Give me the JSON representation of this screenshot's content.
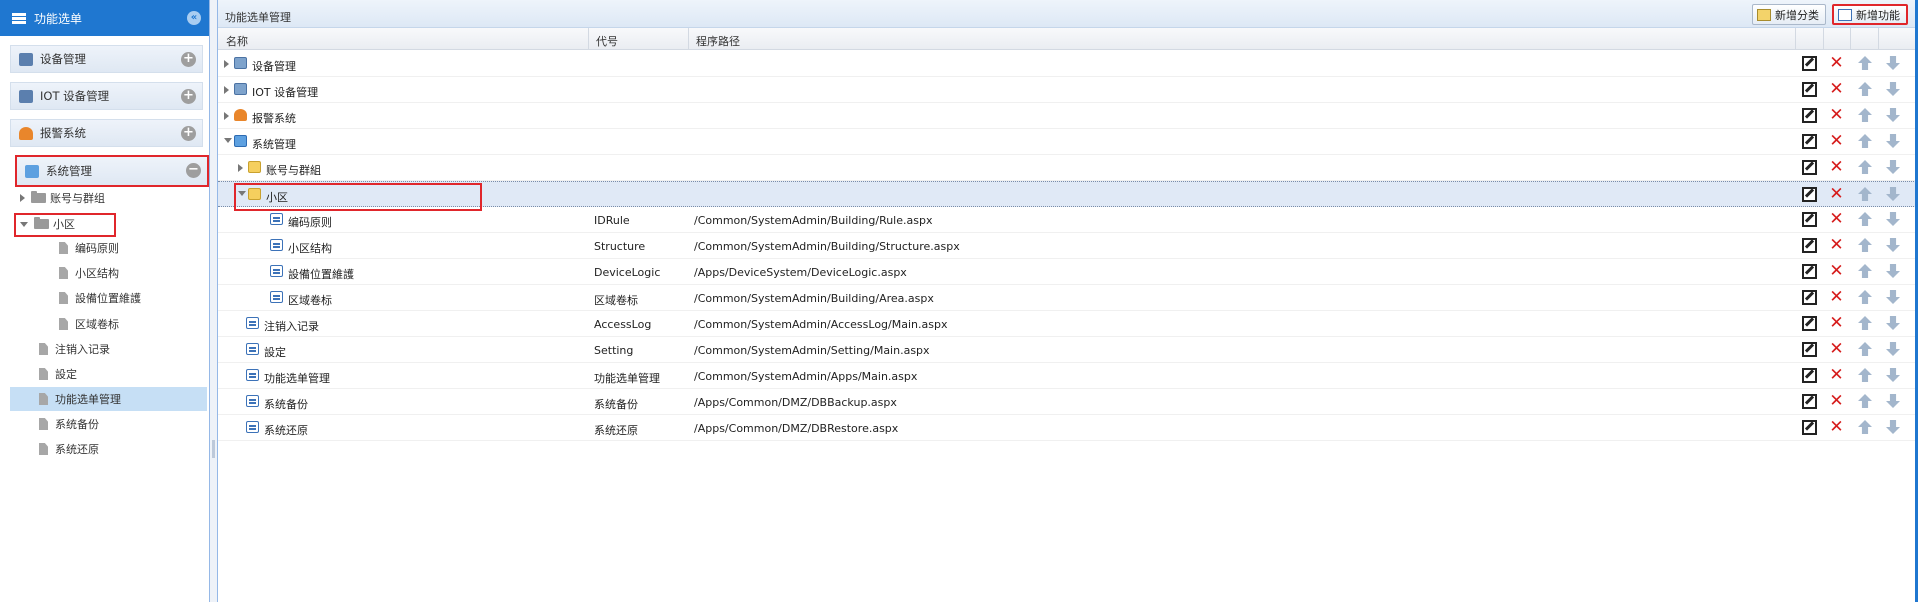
{
  "sidebar": {
    "title": "功能选单",
    "panels": [
      {
        "label": "设备管理",
        "toggle": "+"
      },
      {
        "label": "IOT 设备管理",
        "toggle": "+"
      },
      {
        "label": "报警系统",
        "toggle": "+"
      },
      {
        "label": "系统管理",
        "toggle": "−"
      }
    ],
    "tree": [
      {
        "label": "账号与群组"
      },
      {
        "label": "小区"
      },
      {
        "label": "编码原则"
      },
      {
        "label": "小区结构"
      },
      {
        "label": "設備位置維護"
      },
      {
        "label": "区域卷标"
      },
      {
        "label": "注销入记录"
      },
      {
        "label": "設定"
      },
      {
        "label": "功能选单管理"
      },
      {
        "label": "系统备份"
      },
      {
        "label": "系统还原"
      }
    ]
  },
  "main": {
    "title": "功能选单管理",
    "buttons": {
      "add_category": "新增分类",
      "add_function": "新增功能"
    },
    "columns": {
      "name": "名称",
      "code": "代号",
      "path": "程序路径"
    },
    "rows": [
      {
        "name": "设备管理",
        "code": "",
        "path": "",
        "icon": "device-icon"
      },
      {
        "name": "IOT 设备管理",
        "code": "",
        "path": "",
        "icon": "device-icon"
      },
      {
        "name": "报警系统",
        "code": "",
        "path": "",
        "icon": "alarm-icon"
      },
      {
        "name": "系统管理",
        "code": "",
        "path": "",
        "icon": "system-icon"
      },
      {
        "name": "账号与群組",
        "code": "",
        "path": "",
        "icon": "folder-icon"
      },
      {
        "name": "小区",
        "code": "",
        "path": "",
        "icon": "folder-open-icon"
      },
      {
        "name": "编码原则",
        "code": "IDRule",
        "path": "/Common/SystemAdmin/Building/Rule.aspx",
        "icon": "page-icon"
      },
      {
        "name": "小区结构",
        "code": "Structure",
        "path": "/Common/SystemAdmin/Building/Structure.aspx",
        "icon": "page-icon"
      },
      {
        "name": "設備位置維護",
        "code": "DeviceLogic",
        "path": "/Apps/DeviceSystem/DeviceLogic.aspx",
        "icon": "page-icon"
      },
      {
        "name": "区域卷标",
        "code": "区域卷标",
        "path": "/Common/SystemAdmin/Building/Area.aspx",
        "icon": "page-icon"
      },
      {
        "name": "注销入记录",
        "code": "AccessLog",
        "path": "/Common/SystemAdmin/AccessLog/Main.aspx",
        "icon": "page-icon"
      },
      {
        "name": "設定",
        "code": "Setting",
        "path": "/Common/SystemAdmin/Setting/Main.aspx",
        "icon": "page-icon"
      },
      {
        "name": "功能选单管理",
        "code": "功能选单管理",
        "path": "/Common/SystemAdmin/Apps/Main.aspx",
        "icon": "page-icon"
      },
      {
        "name": "系统备份",
        "code": "系统备份",
        "path": "/Apps/Common/DMZ/DBBackup.aspx",
        "icon": "page-icon"
      },
      {
        "name": "系统还原",
        "code": "系统还原",
        "path": "/Apps/Common/DMZ/DBRestore.aspx",
        "icon": "page-icon"
      }
    ]
  },
  "colors": {
    "header_blue": "#1f77d0",
    "highlight_red": "#e0262b",
    "selection": "#c6dff5"
  }
}
